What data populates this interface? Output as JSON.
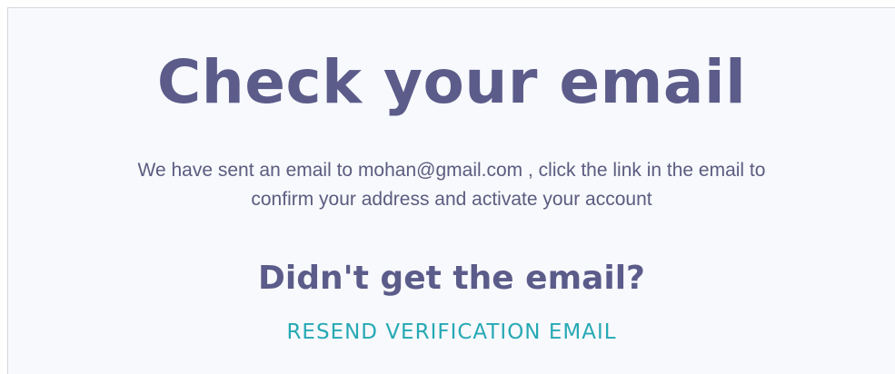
{
  "heading": "Check your email",
  "message": {
    "line1": "We have sent an email to mohan@gmail.com , click the link in the email to",
    "line2": "confirm your address and activate your account"
  },
  "prompt": "Didn't get the email?",
  "resend_label": "RESEND VERIFICATION EMAIL",
  "colors": {
    "heading": "#5b5c8a",
    "body_text": "#5b5c80",
    "link": "#26a9b4",
    "card_background": "#f8f9fc"
  }
}
